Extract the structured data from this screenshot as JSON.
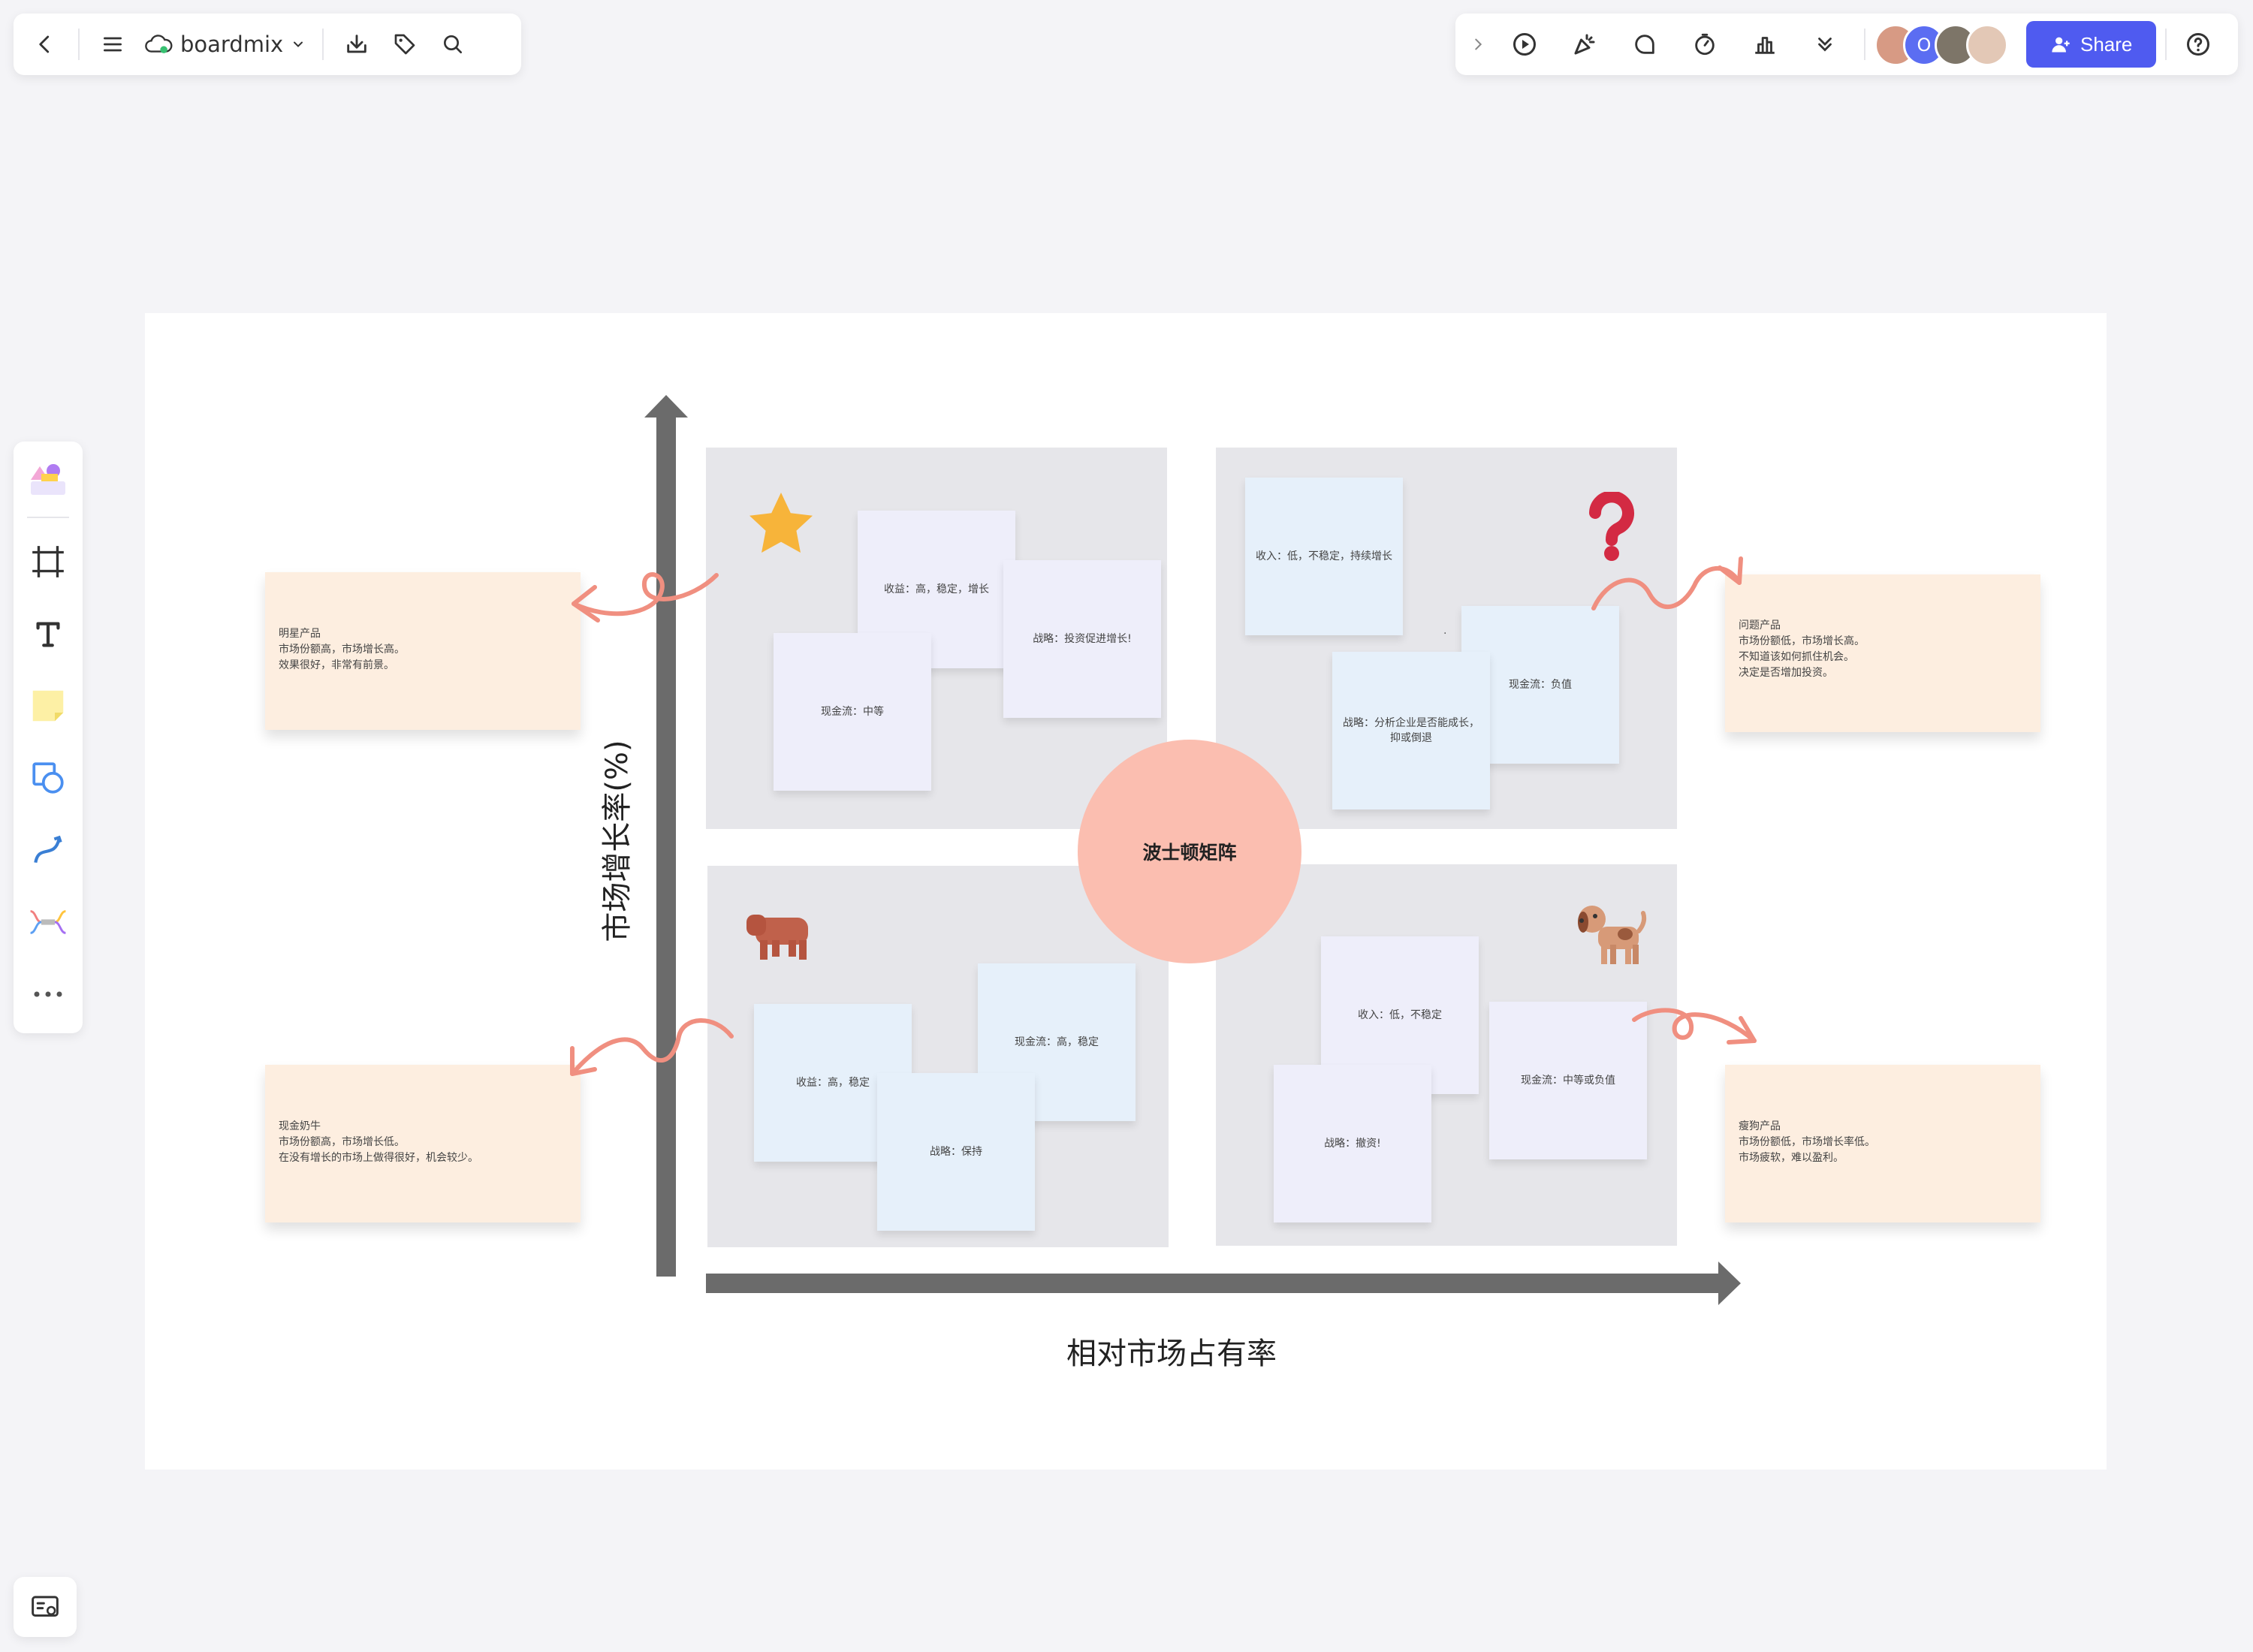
{
  "app": {
    "brand": "boardmix"
  },
  "topbar_right": {
    "share_label": "Share",
    "avatar_initial": "O"
  },
  "board": {
    "center_label": "波士顿矩阵",
    "x_axis_label": "相对市场占有率",
    "y_axis_label": "市场增长率(%)"
  },
  "quadrants": {
    "star": {
      "icon": "star-icon",
      "stickies": [
        "收益：高，稳定，增长",
        "战略：投资促进增长!",
        "现金流：中等"
      ]
    },
    "question": {
      "icon": "question-mark-icon",
      "stickies": [
        "收入：低，不稳定，持续增长",
        "现金流：负值",
        "战略：分析企业是否能成长，抑或倒退"
      ],
      "dot": "·"
    },
    "cow": {
      "icon": "cow-icon",
      "stickies": [
        "现金流：高，稳定",
        "收益：高，稳定",
        "战略：保持"
      ]
    },
    "dog": {
      "icon": "dog-icon",
      "stickies": [
        "收入：低，不稳定",
        "现金流：中等或负值",
        "战略：撤资!"
      ]
    }
  },
  "notes": {
    "star": [
      "明星产品",
      "市场份额高，市场增长高。",
      "效果很好，非常有前景。"
    ],
    "question": [
      "问题产品",
      "市场份额低，市场增长高。",
      "不知道该如何抓住机会。",
      "决定是否增加投资。"
    ],
    "cow": [
      "现金奶牛",
      "市场份额高，市场增长低。",
      "在没有增长的市场上做得很好，机会较少。"
    ],
    "dog": [
      "瘦狗产品",
      "市场份额低，市场增长率低。",
      "市场疲软，难以盈利。"
    ]
  },
  "colors": {
    "accent": "#4f5bf0",
    "quadrant_bg": "#e6e6ea",
    "circle": "#fbbeb0",
    "note_bg": "#fdeee0",
    "arrow_pink": "#f08f80",
    "axis": "#6b6b6b"
  }
}
